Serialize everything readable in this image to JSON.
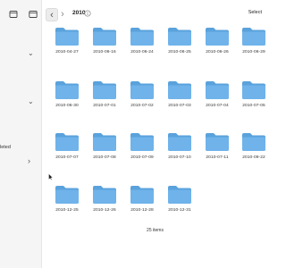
{
  "toolbar": {
    "title": "2010",
    "select_label": "Select",
    "back_icon": "chevron-left-icon",
    "forward_icon": "chevron-right-icon",
    "info_icon": "info-icon"
  },
  "sidebar": {
    "partial_text": "leted"
  },
  "folders": [
    "2010-04-27",
    "2010-06-16",
    "2010-06-24",
    "2010-06-25",
    "2010-06-26",
    "2010-06-29",
    "2010-06-30",
    "2010-07-01",
    "2010-07-02",
    "2010-07-03",
    "2010-07-04",
    "2010-07-05",
    "2010-07-07",
    "2010-07-08",
    "2010-07-09",
    "2010-07-10",
    "2010-07-11",
    "2010-09-22",
    "2010-12-25",
    "2010-12-26",
    "2010-12-28",
    "2010-12-31"
  ],
  "footer": {
    "item_count": "25 items"
  },
  "colors": {
    "folder": "#6fb3ea",
    "folder_dark": "#5aa2dc",
    "accent": "#1e7ad6"
  }
}
